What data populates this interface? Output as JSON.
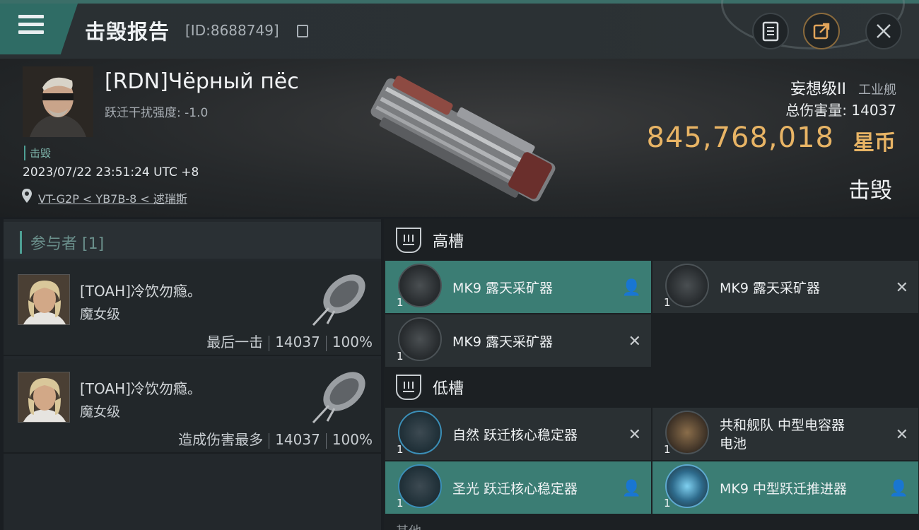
{
  "header": {
    "title": "击毁报告",
    "report_id": "[ID:8688749]"
  },
  "victim": {
    "name": "[RDN]Чёрный пёс",
    "warp_disruption": "跃迁干扰强度: -1.0",
    "status_tag": "击毁",
    "timestamp": "2023/07/22 23:51:24 UTC +8",
    "location": "VT-G2P < YB7B-8 < 逑瑞斯",
    "ship_class": "妄想级II",
    "ship_type": "工业舰",
    "total_damage": "总伤害量: 14037",
    "isk_value": "845,768,018",
    "isk_unit": "星币",
    "result": "击毁"
  },
  "participants": {
    "title": "参与者 [1]",
    "items": [
      {
        "name": "[TOAH]冷饮勿瘾。",
        "ship": "魔女级",
        "role": "最后一击",
        "damage": "14037",
        "percent": "100%"
      },
      {
        "name": "[TOAH]冷饮勿瘾。",
        "ship": "魔女级",
        "role": "造成伤害最多",
        "damage": "14037",
        "percent": "100%"
      }
    ]
  },
  "slots": {
    "high_label": "高槽",
    "low_label": "低槽",
    "other_label": "其他",
    "high": [
      {
        "name": "MK9 露天采矿器",
        "qty": "1",
        "mark": "👤",
        "active": true
      },
      {
        "name": "MK9 露天采矿器",
        "qty": "1",
        "mark": "✕",
        "active": false
      },
      {
        "name": "MK9 露天采矿器",
        "qty": "1",
        "mark": "✕",
        "active": false
      }
    ],
    "low": [
      {
        "name": "自然 跃迁核心稳定器",
        "qty": "1",
        "mark": "✕",
        "active": false
      },
      {
        "name_line1": "共和舰队 中型电容器",
        "name_line2": "电池",
        "qty": "1",
        "mark": "✕",
        "active": false
      },
      {
        "name": "圣光 跃迁核心稳定器",
        "qty": "1",
        "mark": "👤",
        "active": true
      },
      {
        "name": "MK9 中型跃迁推进器",
        "qty": "1",
        "mark": "👤",
        "active": true
      }
    ]
  },
  "colors": {
    "accent_teal": "#3b7d74",
    "isk_gold": "#e8b465",
    "background": "#1a1e22"
  }
}
